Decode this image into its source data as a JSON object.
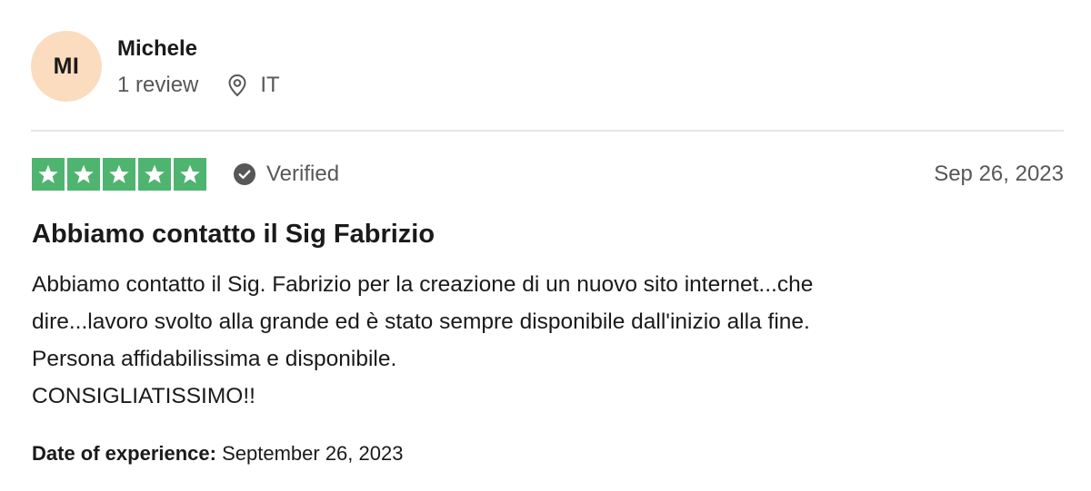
{
  "reviewer": {
    "initials": "MI",
    "name": "Michele",
    "review_count": "1 review",
    "location_icon": "location-pin-icon",
    "country": "IT",
    "avatar_color": "#fbdcbf"
  },
  "rating": {
    "stars": 5,
    "max_stars": 5,
    "star_color": "#4fb46f",
    "verified_label": "Verified",
    "verified_icon": "check-circle-icon",
    "date": "Sep 26, 2023"
  },
  "review": {
    "title": "Abbiamo contatto il Sig Fabrizio",
    "body_lines": [
      "Abbiamo contatto il Sig. Fabrizio per la creazione di un nuovo sito internet...che",
      "dire...lavoro svolto alla grande ed è stato sempre disponibile dall'inizio alla fine.",
      "Persona affidabilissima e disponibile.",
      "CONSIGLIATISSIMO!!"
    ]
  },
  "experience": {
    "label": "Date of experience:",
    "value": "September 26, 2023"
  }
}
